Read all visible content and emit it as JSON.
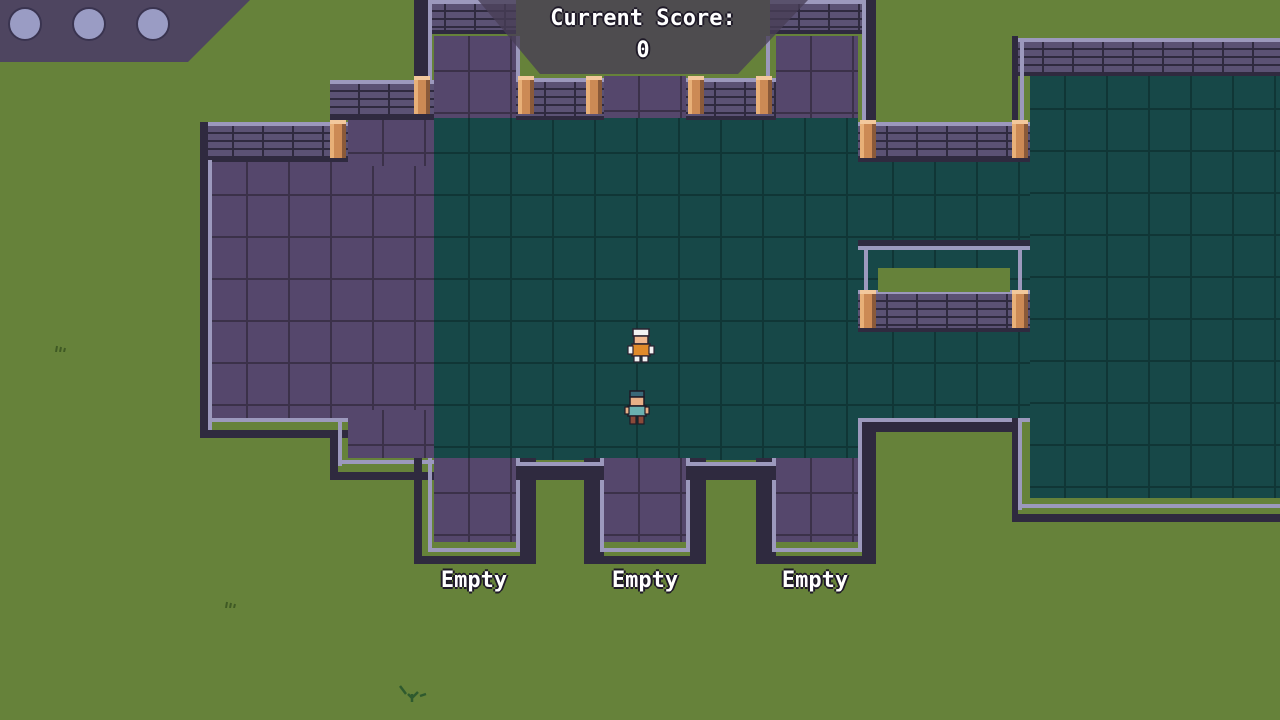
{
  "hud": {
    "lives": [
      "life-token",
      "life-token",
      "life-token"
    ],
    "score_label": "Current Score:",
    "score_value": "0"
  },
  "slots": [
    {
      "label": "Empty"
    },
    {
      "label": "Empty"
    },
    {
      "label": "Empty"
    }
  ],
  "colors": {
    "grass": "#66823a",
    "purple_floor": "#55476c",
    "teal_floor": "#174848",
    "wall_stone": "#5b5274",
    "wall_trim": "#9c99bd",
    "wall_shadow": "#2f2a3f",
    "post": "#cc8a55",
    "life_token": "#9a9cc4"
  },
  "characters": [
    {
      "name": "chef-npc-icon"
    },
    {
      "name": "player-character-icon"
    }
  ]
}
